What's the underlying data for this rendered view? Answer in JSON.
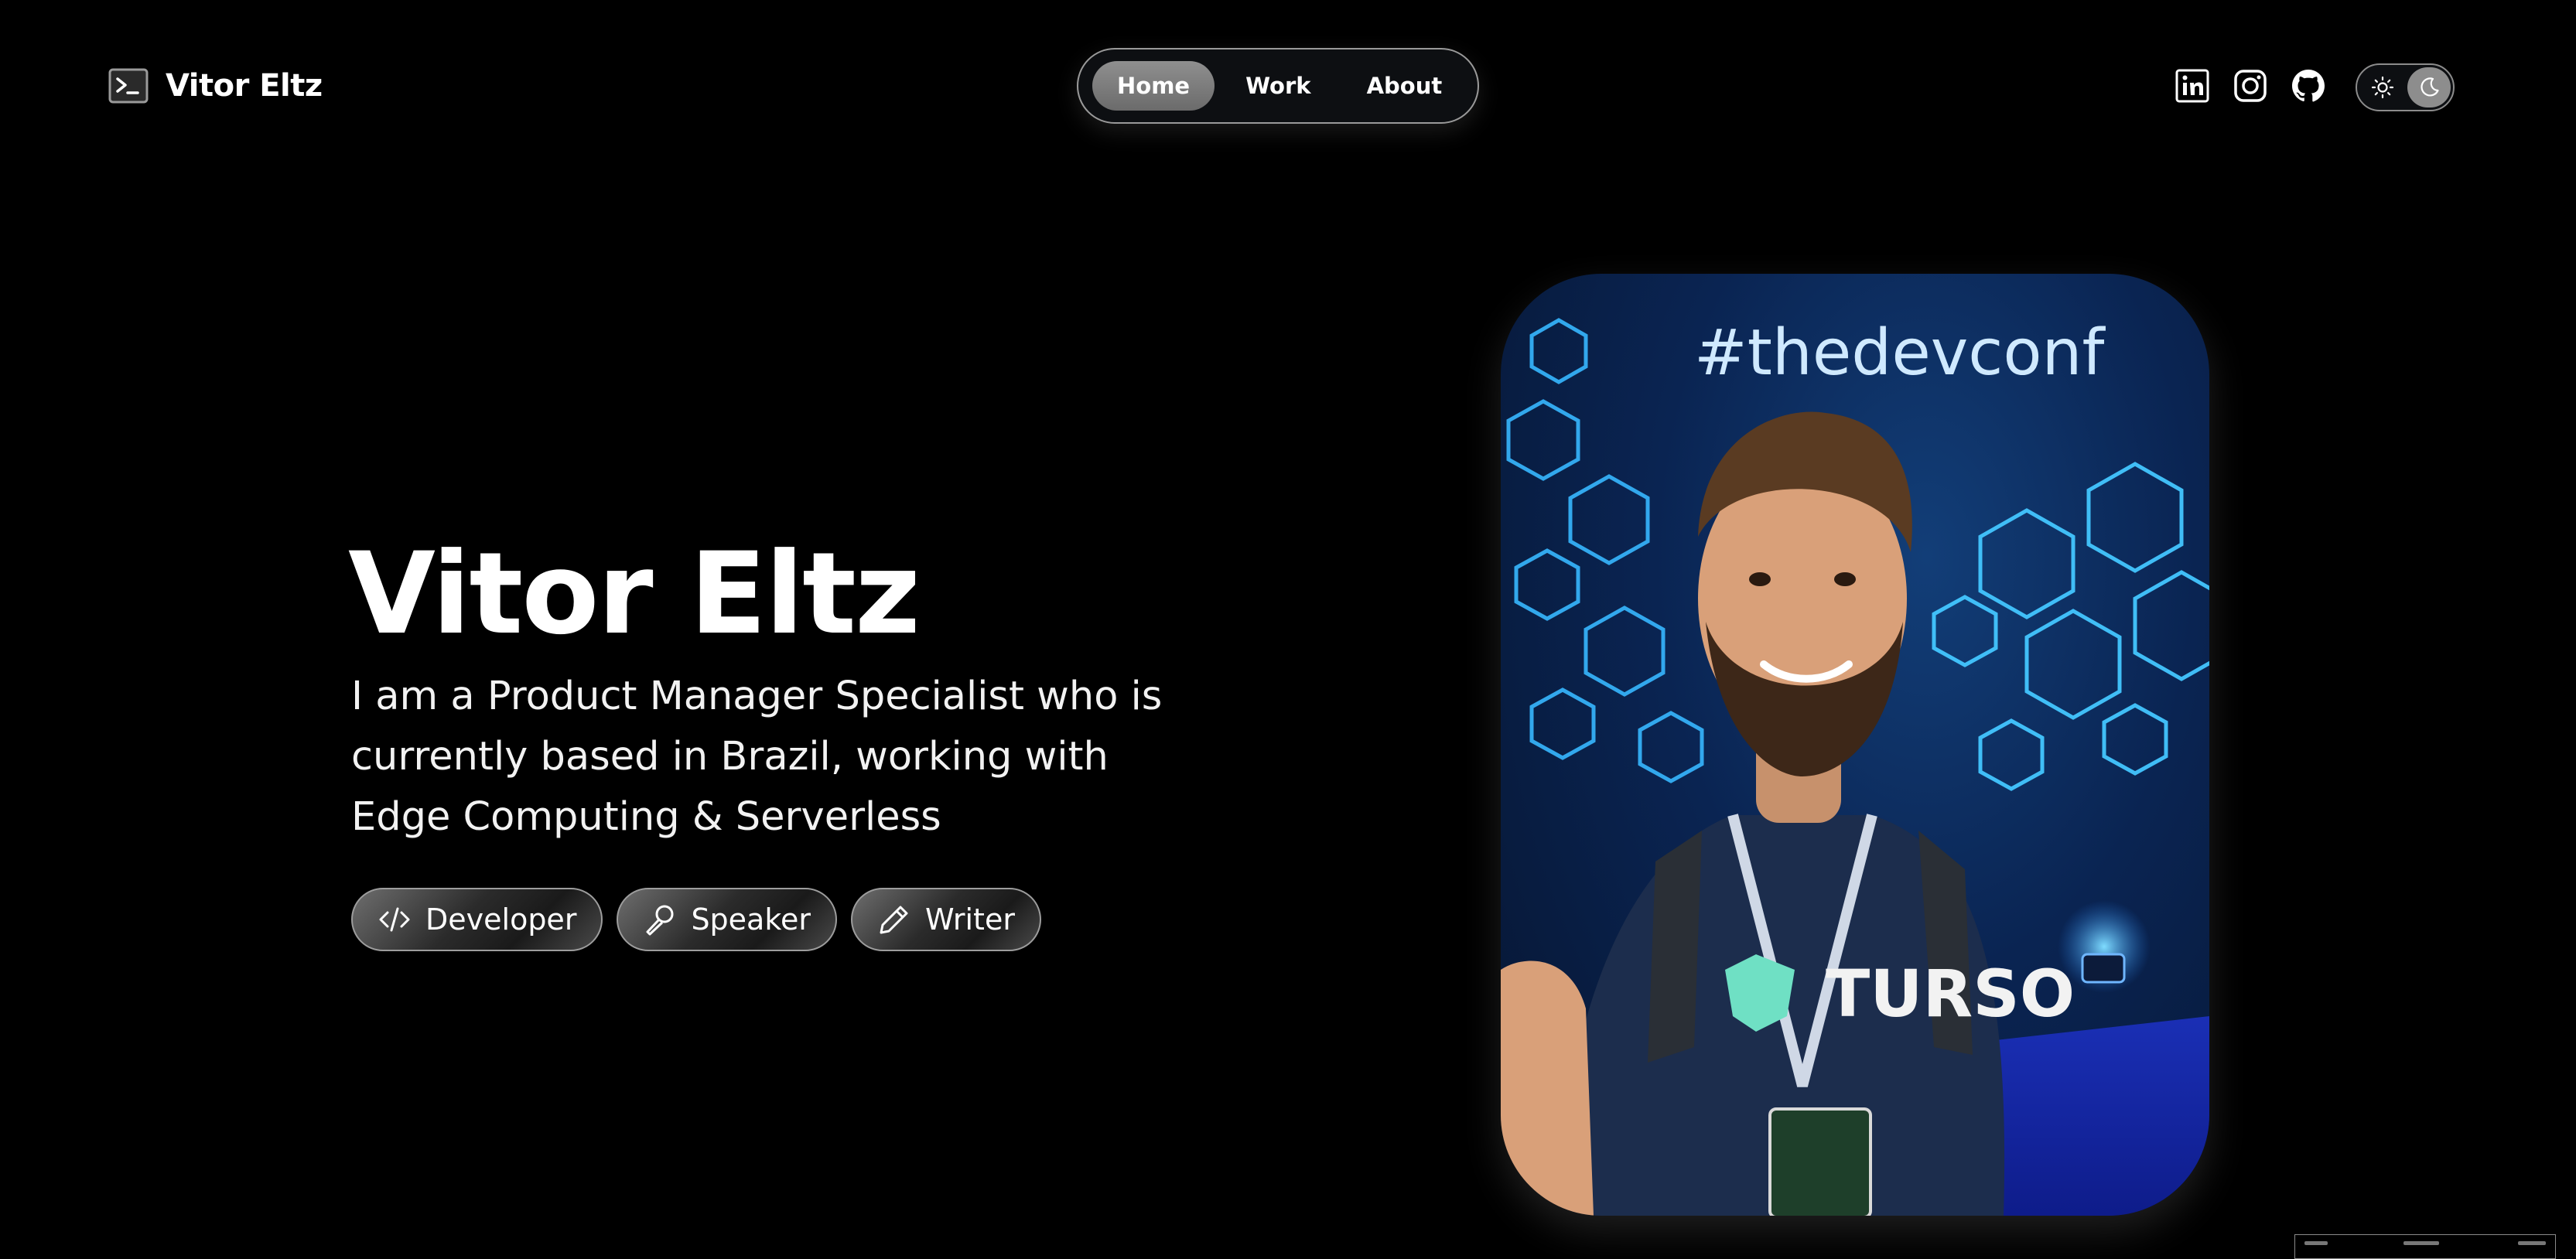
{
  "header": {
    "brand": "Vitor Eltz",
    "brand_icon": "terminal-icon",
    "nav": [
      {
        "label": "Home",
        "active": true
      },
      {
        "label": "Work",
        "active": false
      },
      {
        "label": "About",
        "active": false
      }
    ],
    "social_icons": [
      "linkedin-icon",
      "instagram-icon",
      "github-icon"
    ],
    "theme_toggle": {
      "options": [
        "sun-icon",
        "moon-icon"
      ],
      "selected": "dark"
    }
  },
  "hero": {
    "name": "Vitor Eltz",
    "bio": "I am a Product Manager Specialist who is currently based in Brazil, working with Edge Computing & Serverless",
    "tags": [
      {
        "label": "Developer",
        "icon": "code-icon"
      },
      {
        "label": "Speaker",
        "icon": "microphone-icon"
      },
      {
        "label": "Writer",
        "icon": "pencil-icon"
      }
    ]
  },
  "portrait": {
    "backdrop_text": "#thedevconf",
    "shirt_text": "TURSO"
  },
  "colors": {
    "background": "#000000",
    "text": "#ffffff",
    "nav_active": "#7a7a7a",
    "border": "#9a9a9a",
    "portrait_glow": "#3fb8ff"
  }
}
